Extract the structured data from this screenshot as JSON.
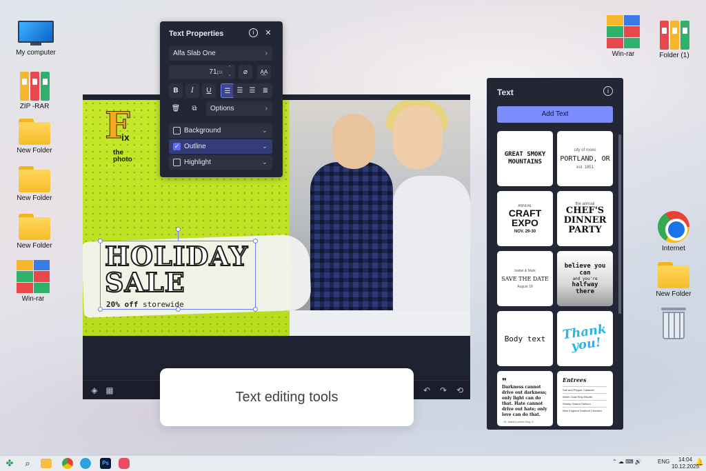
{
  "desktop": {
    "icons_left": [
      {
        "label": "My computer",
        "icon": "computer-icon"
      },
      {
        "label": "ZIP -RAR",
        "icon": "archive-icon"
      },
      {
        "label": "New Folder",
        "icon": "folder-icon"
      },
      {
        "label": "New Folder",
        "icon": "folder-icon"
      },
      {
        "label": "New Folder",
        "icon": "folder-icon"
      },
      {
        "label": "Win-rar",
        "icon": "winrar-icon"
      }
    ],
    "icons_right": [
      {
        "label": "Win-rar",
        "icon": "winrar-icon"
      },
      {
        "label": "Folder (1)",
        "icon": "archive-icon"
      },
      {
        "label": "Internet",
        "icon": "chrome-icon"
      },
      {
        "label": "New Folder",
        "icon": "folder-icon"
      },
      {
        "label": "",
        "icon": "recycle-bin-icon"
      }
    ]
  },
  "canvas": {
    "logo_letter": "F",
    "logo_sub": "ix",
    "logo_line1": "the",
    "logo_line2": "photo",
    "headline_line1": "HOLIDAY",
    "headline_line2": "SALE",
    "sub_bold": "20% off",
    "sub_rest": "storewide",
    "accent_color": "#c7e82a"
  },
  "text_properties": {
    "title": "Text Properties",
    "font_family": "Alfa Slab One",
    "font_size": "71",
    "font_unit": "px",
    "format_buttons": [
      "B",
      "I",
      "U"
    ],
    "options_label": "Options",
    "toggles": [
      {
        "label": "Background",
        "checked": false
      },
      {
        "label": "Outline",
        "checked": true
      },
      {
        "label": "Highlight",
        "checked": false
      }
    ]
  },
  "text_panel": {
    "title": "Text",
    "add_button": "Add Text",
    "accent_color": "#7b8cff",
    "templates": {
      "t1": "GREAT SMOKY MOUNTAINS",
      "t2_top": "city of roses",
      "t2_main": "PORTLAND, OR",
      "t2_est": "est. 1851",
      "t3_top": "ANNUAL",
      "t3_main": "CRAFT EXPO",
      "t3_date": "NOV. 29-30",
      "t4_top": "the annual",
      "t4_main": "CHEF'S DINNER PARTY",
      "t5_top": "Isabel & Mark",
      "t5_main": "SAVE THE DATE",
      "t5_date": "August 18",
      "t6_a": "believe you can",
      "t6_b": "and you're",
      "t6_c": "halfway there",
      "t7": "Body text",
      "t8": "Thank you!",
      "t9_quote": "Darkness cannot drive out darkness; only light can do that. Hate cannot drive out hate; only love can do that.",
      "t9_author": "- Dr. Martin Luther King Jr.",
      "t10_title": "Entrees",
      "t10_items": [
        "Salt and Pepper Calamari",
        "Warm Goat Ring Risotto",
        "Smoky Glazed Salmon",
        "New England Seafood Chowder"
      ]
    }
  },
  "caption": "Text editing tools",
  "taskbar": {
    "lang": "ENG",
    "time": "14:04",
    "date": "10.12.2025"
  }
}
